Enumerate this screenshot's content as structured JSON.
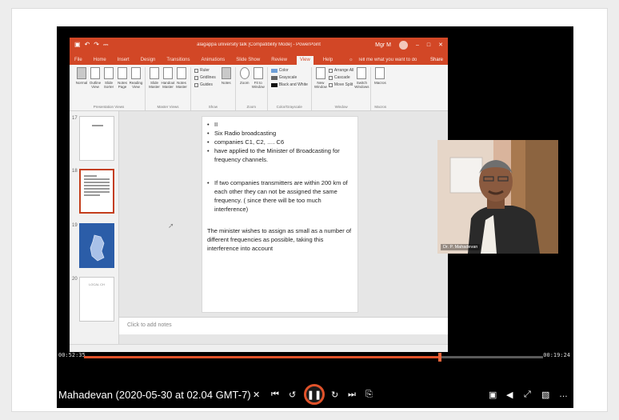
{
  "powerpoint": {
    "window_title": "alagappa university talk [Compatibility Mode] - PowerPoint",
    "user": "Mgr M",
    "quick_access": [
      "▣",
      "↶",
      "↷",
      "⎓"
    ],
    "window_controls": [
      "–",
      "□",
      "✕"
    ],
    "tabs": [
      "File",
      "Home",
      "Insert",
      "Design",
      "Transitions",
      "Animations",
      "Slide Show",
      "Review",
      "View",
      "Help"
    ],
    "active_tab": "View",
    "tell_me": "Tell me what you want to do",
    "share": "Share",
    "ribbon": {
      "presentation_views": {
        "label": "Presentation Views",
        "buttons": [
          "Normal",
          "Outline View",
          "Slide Sorter",
          "Notes Page",
          "Reading View"
        ]
      },
      "master_views": {
        "label": "Master Views",
        "buttons": [
          "Slide Master",
          "Handout Master",
          "Notes Master"
        ]
      },
      "show": {
        "label": "Show",
        "checks": [
          "Ruler",
          "Gridlines",
          "Guides"
        ]
      },
      "notes_btn": "Notes",
      "zoom": {
        "label": "Zoom",
        "buttons": [
          "Zoom",
          "Fit to Window"
        ]
      },
      "color": {
        "label": "Color/Grayscale",
        "options": [
          "Color",
          "Grayscale",
          "Black and White"
        ]
      },
      "window": {
        "label": "Window",
        "new_window": "New Window",
        "options": [
          "Arrange All",
          "Cascade",
          "Move Split"
        ],
        "switch": "Switch Windows"
      },
      "macros": {
        "label": "Macros",
        "button": "Macros"
      }
    },
    "thumbnails": {
      "numbers": [
        "17",
        "18",
        "19",
        "20"
      ],
      "last_text": "LOCAL CH"
    },
    "slide": {
      "bullets": [
        "II",
        "Six  Radio  broadcasting",
        "companies C1, C2, …. C6",
        "have applied to the Minister of Broadcasting for frequency channels.",
        "If two companies transmitters are within 200 km of each other they can not be assigned the same frequency. ( since there will be too much interference)"
      ],
      "paragraph": "The minister  wishes to assign as small as a number of different frequencies as possible, taking this interference into account"
    },
    "notes_placeholder": "Click to add notes"
  },
  "webcam": {
    "caption": "Dr. P. Mahadevan"
  },
  "player": {
    "elapsed": "00:52:35",
    "total": "00:19:24",
    "progress": 0.776,
    "title": "Mahadevan (2020-05-30 at 02.04 GMT-7)",
    "controls": {
      "shuffle": "✕",
      "prev": "⏮",
      "rewind": "↺",
      "play": "❚❚",
      "forward": "↻",
      "next": "⏭",
      "captions": "⎘",
      "settings": "▣",
      "volume": "◀",
      "fullscreen": "⤢",
      "pip": "▧",
      "more": "…"
    }
  },
  "colors": {
    "ppt_accent": "#d24726",
    "progress": "#e0522a"
  }
}
